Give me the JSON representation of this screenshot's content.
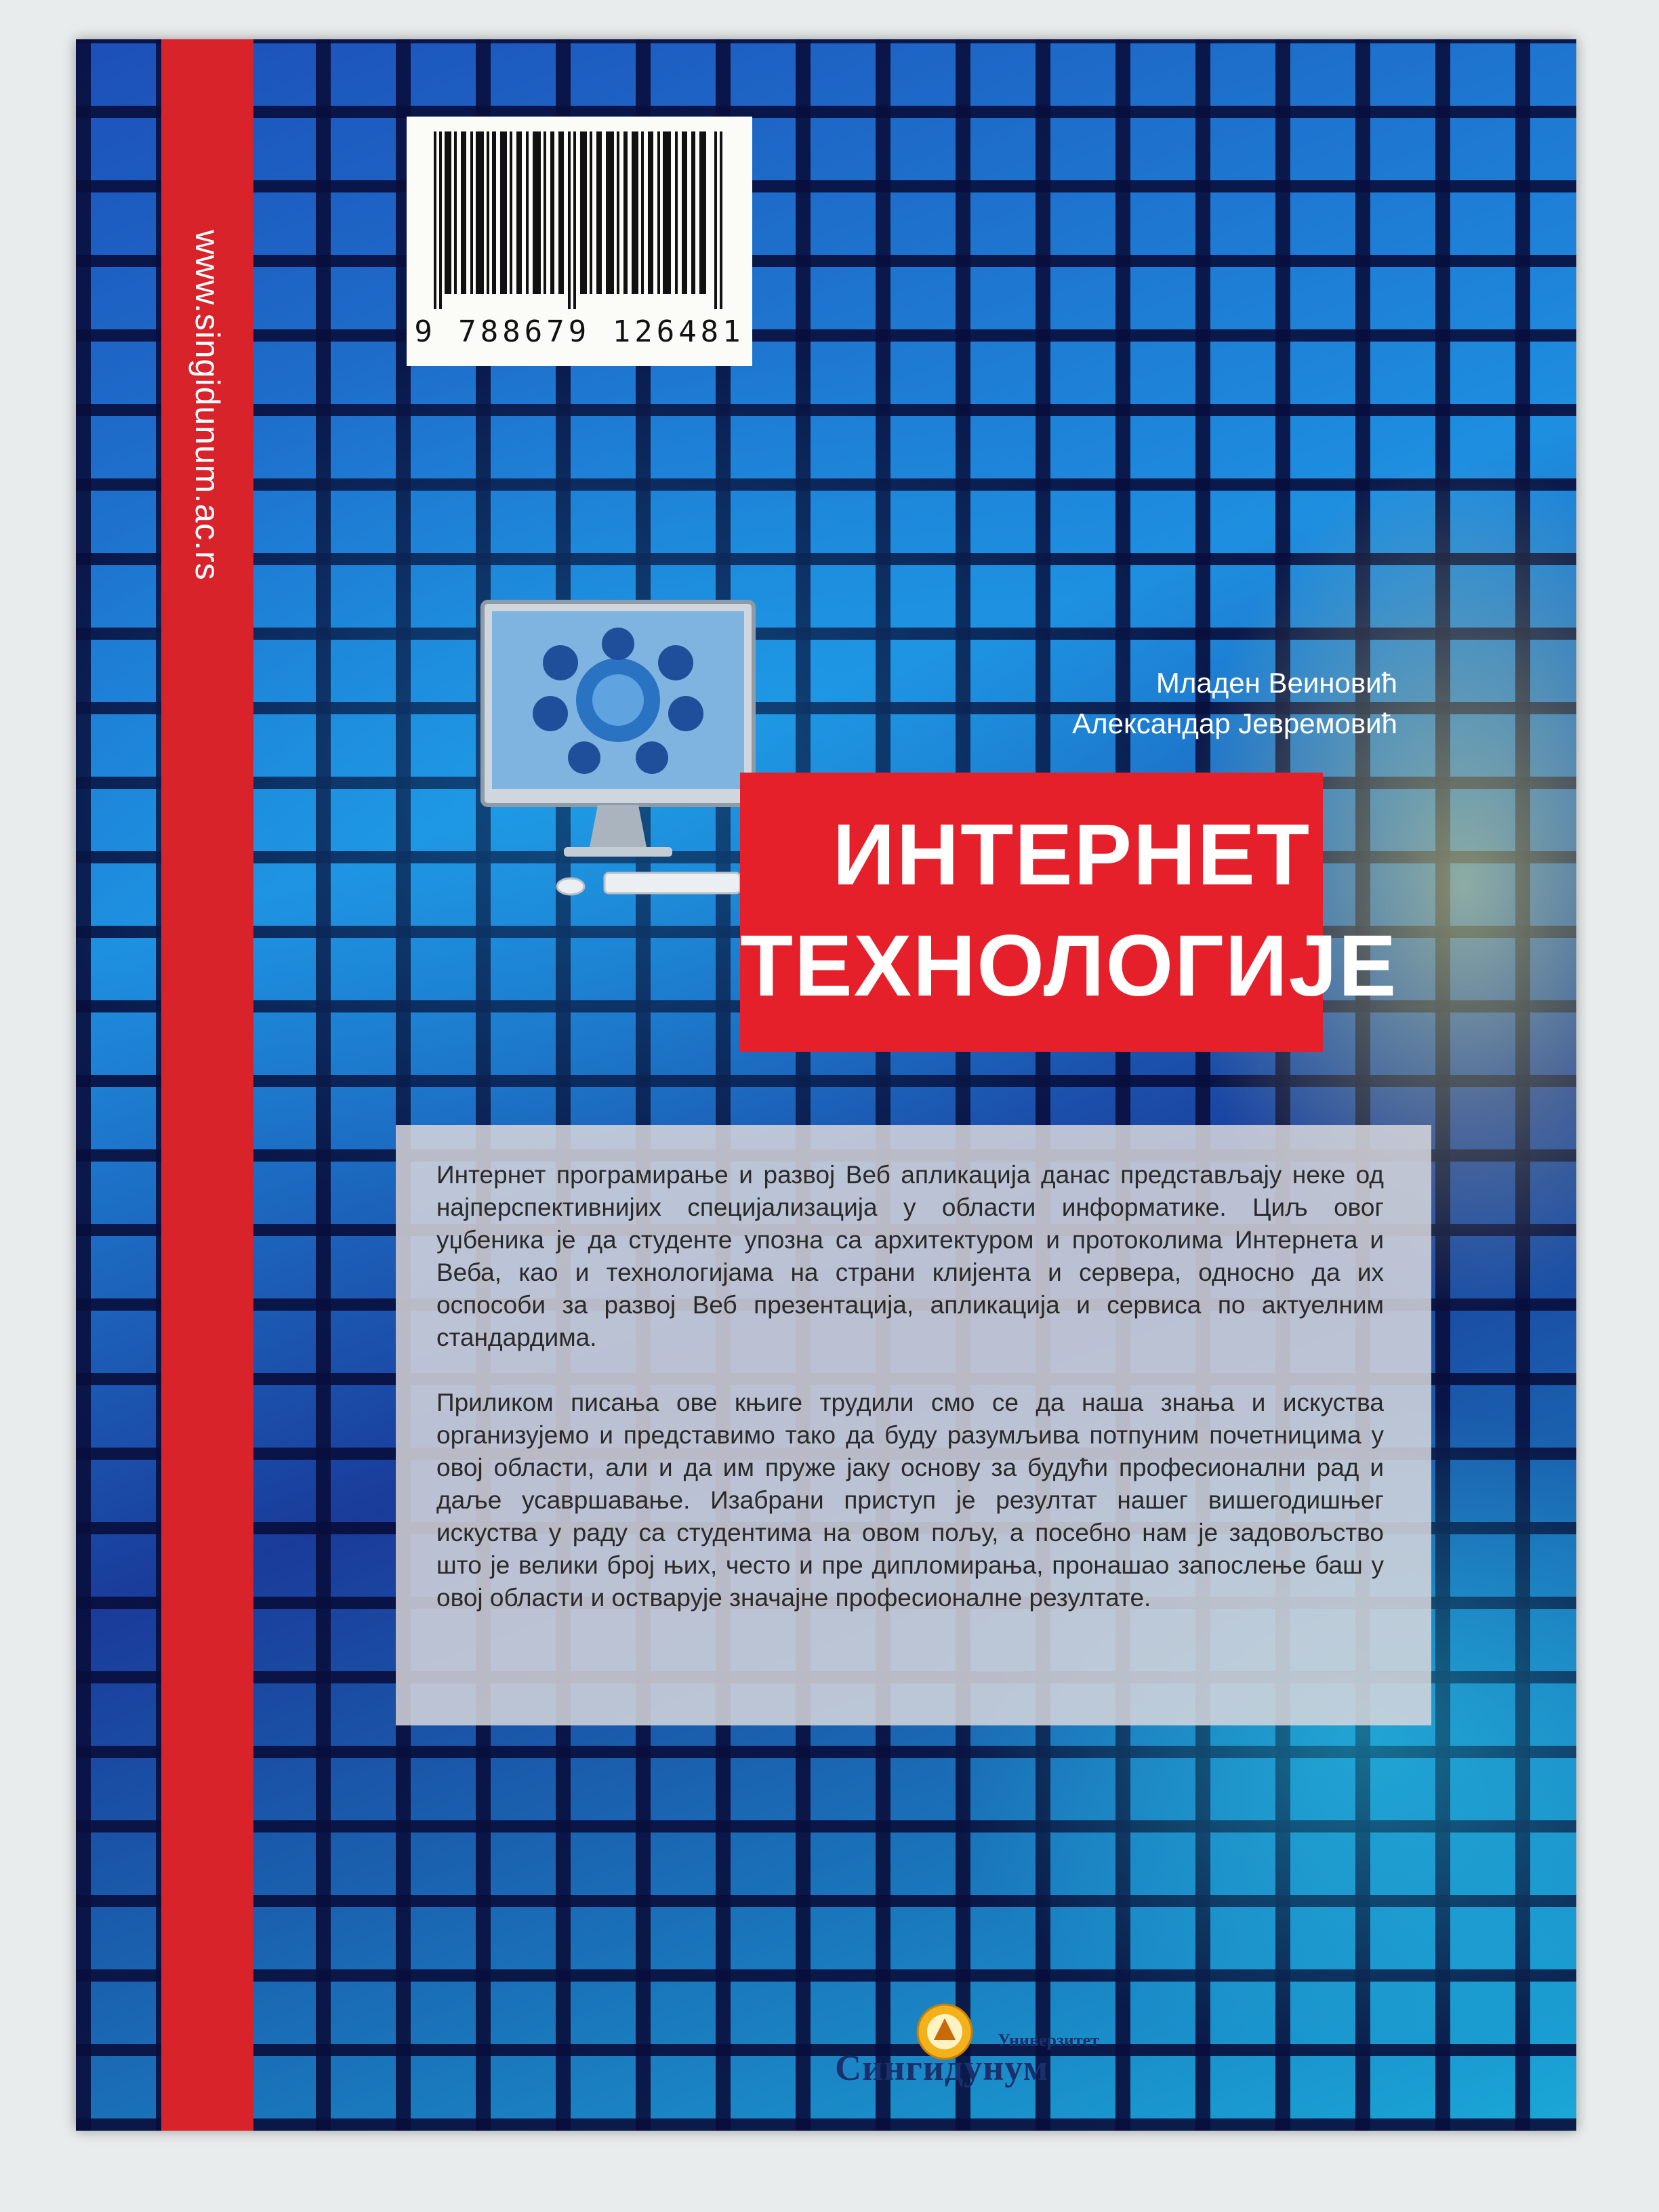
{
  "cover": {
    "website": "www.singidunum.ac.rs",
    "isbn": "9 788679 126481",
    "authors": [
      "Младен Веиновић",
      "Александар Јевремовић"
    ],
    "title_lines": [
      "ИНТЕРНЕТ",
      "ТЕХНОЛОГИЈЕ"
    ],
    "paragraphs": [
      "Интернет програмирање и развој Веб апликација данас представљају неке од најперспективнијих специјализација у области информатике. Циљ овог уџбеника је да студенте упозна са архитектуром и протоколима Интернета и Веба, као и технологијама на страни клијента и сервера, односно да их оспособи за развој Веб презентација, апликација и сервиса по актуелним стандардима.",
      "Приликом писања ове књиге трудили смо се да наша знања и искуства организујемо и представимо тако да буду разумљива потпуним почетницима у овој области, али и да им пруже јаку основу за будући професионални рад и даље усавршавање. Изабрани приступ је резултат нашег вишегодишњег искуства у раду са студентима на овом пољу, а посебно нам је задовољство што је велики број њих, често и пре дипломирања, пронашао запослење баш у овој области и остварује значајне професионалне резултате."
    ],
    "publisher": {
      "small": "Универзитет",
      "name": "Сингидунум"
    }
  },
  "colors": {
    "spine_red": "#d8232a",
    "title_red": "#e5202b",
    "publisher_blue": "#1a2f6b"
  },
  "icons": [
    "barcode-icon",
    "computer-monitor-icon",
    "university-logo-icon"
  ]
}
